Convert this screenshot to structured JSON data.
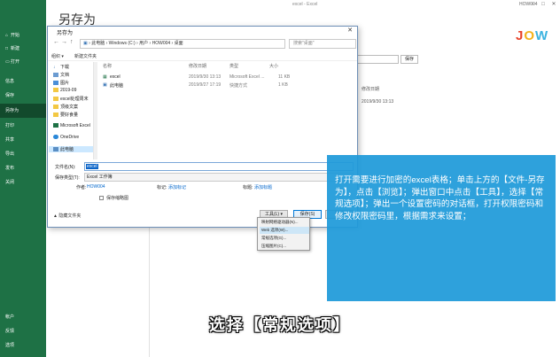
{
  "colors": {
    "sidebar": "#1e7145",
    "info_panel": "#1e9ad9",
    "accent": "#0078d7"
  },
  "window": {
    "title": "excel - Excel",
    "user": "HOW004",
    "min": "−",
    "max": "□",
    "close": "✕"
  },
  "sidebar": {
    "items": [
      {
        "icon": "back-icon",
        "label": "开始"
      },
      {
        "icon": "new-icon",
        "label": "新建"
      },
      {
        "icon": "open-icon",
        "label": "打开"
      },
      {
        "icon": "",
        "label": "信息"
      },
      {
        "icon": "",
        "label": "保存"
      },
      {
        "icon": "",
        "label": "另存为"
      },
      {
        "icon": "",
        "label": "打印"
      },
      {
        "icon": "",
        "label": "共享"
      },
      {
        "icon": "",
        "label": "导出"
      },
      {
        "icon": "",
        "label": "发布"
      },
      {
        "icon": "",
        "label": "关闭"
      }
    ],
    "bottom": [
      {
        "label": "帐户"
      },
      {
        "label": "反馈"
      },
      {
        "label": "选项"
      }
    ]
  },
  "backstage": {
    "title": "另存为",
    "save_label": "保存",
    "mod_date_header": "修改日期",
    "mod_date": "2019/9/30 13:13"
  },
  "logo": {
    "letters": [
      "J",
      "O",
      "W"
    ]
  },
  "dialog": {
    "title": "另存为",
    "close": "✕",
    "address": [
      "此电脑",
      "Windows (C:)",
      "用户",
      "HOW004",
      "桌面"
    ],
    "search_placeholder": "搜索\"桌面\"",
    "toolbar": {
      "organize": "组织 ▾",
      "new_folder": "新建文件夹"
    },
    "nav": [
      {
        "label": "下载",
        "icon": "download-icon"
      },
      {
        "label": "文档",
        "icon": "document-icon"
      },
      {
        "label": "图片",
        "icon": "picture-icon"
      },
      {
        "label": "2019-09",
        "icon": "folder-icon"
      },
      {
        "label": "excel处理周末",
        "icon": "folder-icon"
      },
      {
        "label": "顶级文案",
        "icon": "folder-icon"
      },
      {
        "label": "要好食量",
        "icon": "folder-icon"
      },
      {
        "label": "Microsoft Excel",
        "icon": "excel-icon"
      },
      {
        "label": "OneDrive",
        "icon": "cloud-icon"
      },
      {
        "label": "此电脑",
        "icon": "computer-icon"
      }
    ],
    "columns": [
      "名称",
      "修改日期",
      "类型",
      "大小"
    ],
    "files": [
      {
        "name": "excel",
        "date": "2019/9/30 13:13",
        "type": "Microsoft Excel ...",
        "size": "11 KB"
      },
      {
        "name": "此电脑",
        "date": "2019/9/27 17:19",
        "type": "快捷方式",
        "size": "1 KB"
      }
    ],
    "filename_label": "文件名(N):",
    "filename_value": "excel",
    "filetype_label": "保存类型(T):",
    "filetype_value": "Excel 工作簿",
    "author_label": "作者:",
    "author_value": "HOW004",
    "tags_label": "标记:",
    "tags_value": "添加标记",
    "title_label": "标题:",
    "title_value": "添加标题",
    "thumbnail_label": "保存缩略图",
    "hide_folders": "▲ 隐藏文件夹",
    "tools": "工具(L) ▾",
    "save": "保存(S)",
    "cancel": "取消"
  },
  "tools_menu": [
    {
      "label": "映射网络驱动器(N)...",
      "highlight": false
    },
    {
      "label": "Web 选项(W)...",
      "highlight": true
    },
    {
      "label": "常规选项(G)...",
      "highlight": false
    },
    {
      "label": "压缩图片(C)...",
      "highlight": false
    }
  ],
  "info": "打开需要进行加密的excel表格；单击上方的【文件-另存为】，点击【浏览】；弹出窗口中点击【工具】，选择【常规选项】；弹出一个设置密码的对话框，打开权限密码和修改权限密码里，根据需求来设置；",
  "subtitle": "选择【常规选项】"
}
